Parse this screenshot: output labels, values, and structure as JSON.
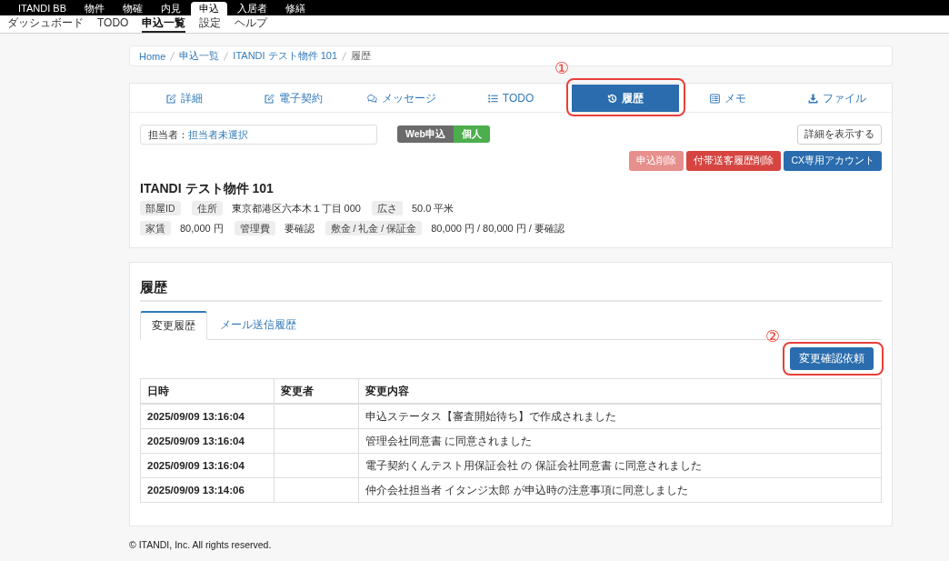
{
  "top_nav": {
    "brand": "ITANDI BB",
    "items": [
      {
        "label": "物件",
        "selected": false
      },
      {
        "label": "物確",
        "selected": false
      },
      {
        "label": "内見",
        "selected": false
      },
      {
        "label": "申込",
        "selected": true
      },
      {
        "label": "入居者",
        "selected": false
      },
      {
        "label": "修繕",
        "selected": false
      }
    ]
  },
  "sub_nav": {
    "items": [
      {
        "label": "ダッシュボード",
        "selected": false
      },
      {
        "label": "TODO",
        "selected": false
      },
      {
        "label": "申込一覧",
        "selected": true
      },
      {
        "label": "設定",
        "selected": false
      },
      {
        "label": "ヘルプ",
        "selected": false
      }
    ]
  },
  "breadcrumb": [
    {
      "label": "Home",
      "current": false
    },
    {
      "label": "申込一覧",
      "current": false
    },
    {
      "label": "ITANDI テスト物件 101",
      "current": false
    },
    {
      "label": "履歴",
      "current": true
    }
  ],
  "tabs": [
    {
      "label": "詳細",
      "selected": false
    },
    {
      "label": "電子契約",
      "selected": false
    },
    {
      "label": "メッセージ",
      "selected": false
    },
    {
      "label": "TODO",
      "selected": false
    },
    {
      "label": "履歴",
      "selected": true,
      "callout": "①"
    },
    {
      "label": "メモ",
      "selected": false
    },
    {
      "label": "ファイル",
      "selected": false
    }
  ],
  "assignee": {
    "label": "担当者：",
    "value": "担当者未選択"
  },
  "badges": [
    {
      "label": "Web申込",
      "color": "#6b6b6b"
    },
    {
      "label": "個人",
      "color": "#4cae4c"
    }
  ],
  "detail_button": "詳細を表示する",
  "action_buttons": [
    {
      "label": "申込削除",
      "kind": "danger",
      "disabled": true
    },
    {
      "label": "付帯送客履歴削除",
      "kind": "danger",
      "disabled": false
    },
    {
      "label": "CX専用アカウント",
      "kind": "primary",
      "disabled": false
    }
  ],
  "property": {
    "title": "ITANDI テスト物件 101",
    "rows": [
      {
        "fields": [
          {
            "label": "部屋ID"
          },
          {
            "label": "住所",
            "value": "東京都港区六本木１丁目 000"
          },
          {
            "label": "広さ",
            "value": "50.0 平米"
          }
        ]
      },
      {
        "fields": [
          {
            "label": "家賃",
            "value": "80,000 円"
          },
          {
            "label": "管理費",
            "value": "要確認"
          },
          {
            "label": "敷金 / 礼金 / 保証金",
            "value": "80,000 円 / 80,000 円 / 要確認"
          }
        ]
      }
    ]
  },
  "history": {
    "title": "履歴",
    "tabs": [
      {
        "label": "変更履歴",
        "selected": true
      },
      {
        "label": "メール送信履歴",
        "selected": false
      }
    ],
    "request_button": {
      "label": "変更確認依頼",
      "callout": "②"
    },
    "table": {
      "columns": [
        "日時",
        "変更者",
        "変更内容"
      ],
      "rows": [
        {
          "datetime": "2025/09/09 13:16:04",
          "content": "申込ステータス【審査開始待ち】で作成されました"
        },
        {
          "datetime": "2025/09/09 13:16:04",
          "content": "管理会社同意書 に同意されました"
        },
        {
          "datetime": "2025/09/09 13:16:04",
          "content": "電子契約くんテスト用保証会社 の 保証会社同意書 に同意されました"
        },
        {
          "datetime": "2025/09/09 13:14:06",
          "content": "仲介会社担当者 イタンジ太郎 が申込時の注意事項に同意しました"
        }
      ]
    }
  },
  "footer": "© ITANDI, Inc. All rights reserved."
}
